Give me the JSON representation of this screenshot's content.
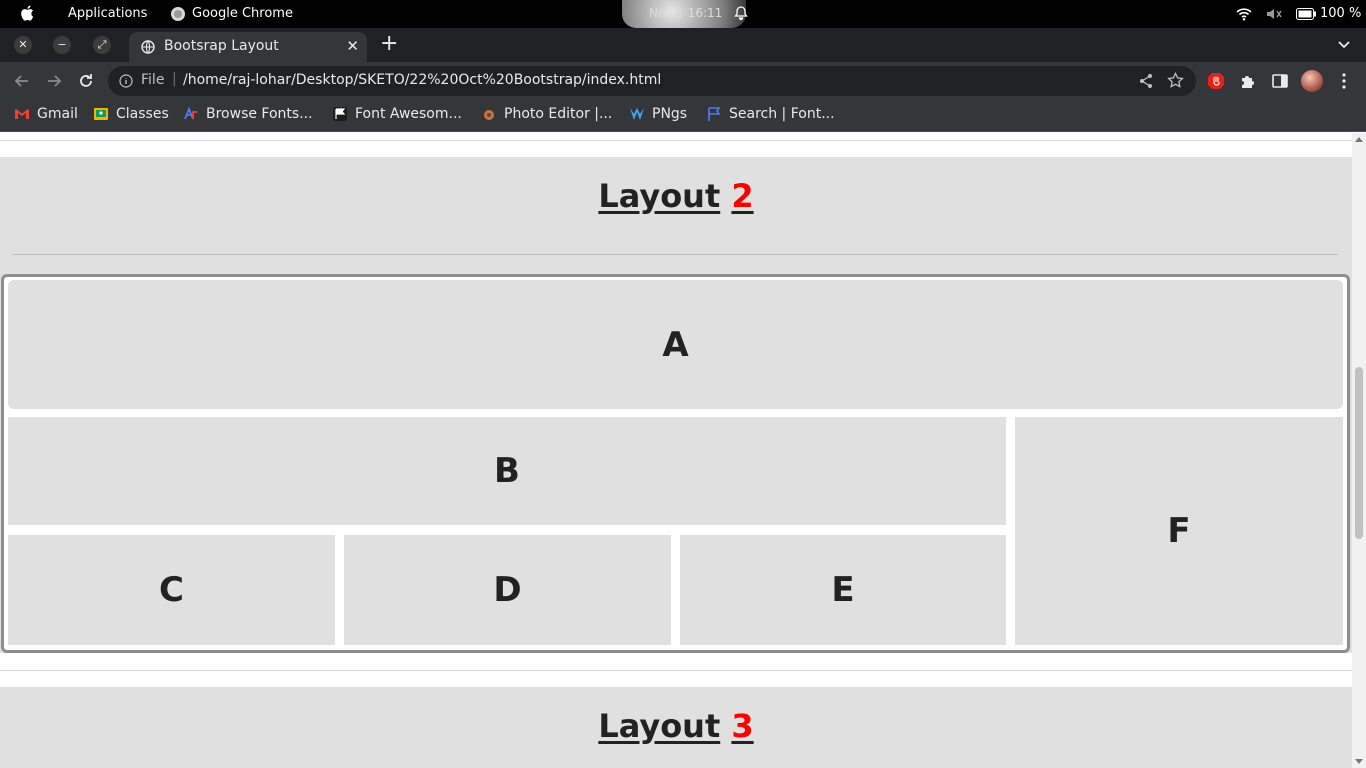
{
  "os": {
    "applications_label": "Applications",
    "active_app": "Google Chrome",
    "clock": "Nov 1  16:11",
    "battery": "100 %"
  },
  "browser": {
    "tab_title": "Bootsrap Layout",
    "new_tab": "+",
    "tab_close": "✕",
    "scheme_label": "File",
    "separator": "|",
    "url": "/home/raj-lohar/Desktop/SKETO/22%20Oct%20Bootstrap/index.html"
  },
  "bookmarks": [
    {
      "label": "Gmail",
      "icon": "gmail-icon",
      "color": "#ea4335"
    },
    {
      "label": "Classes",
      "icon": "classroom-icon",
      "color": "#f4b400"
    },
    {
      "label": "Browse Fonts...",
      "icon": "fonts-icon",
      "color": "#4e7cf6"
    },
    {
      "label": "Font Awesom...",
      "icon": "flag-icon",
      "color": "#ffffff"
    },
    {
      "label": "Photo Editor |...",
      "icon": "photo-editor-icon",
      "color": "#c6782f"
    },
    {
      "label": "PNgs",
      "icon": "pngs-icon",
      "color": "#3fa9f5"
    },
    {
      "label": "Search | Font...",
      "icon": "flag-outline-icon",
      "color": "#4e7cf6"
    }
  ],
  "page": {
    "layout2": {
      "title_text": "Layout",
      "title_number": "2"
    },
    "cells": {
      "a": "A",
      "b": "B",
      "c": "C",
      "d": "D",
      "e": "E",
      "f": "F"
    },
    "layout3": {
      "title_text": "Layout",
      "title_number": "3"
    }
  },
  "colors": {
    "accent_number": "#ff0000",
    "section_bg": "#e0e0e0",
    "chrome_dark": "#202124"
  }
}
